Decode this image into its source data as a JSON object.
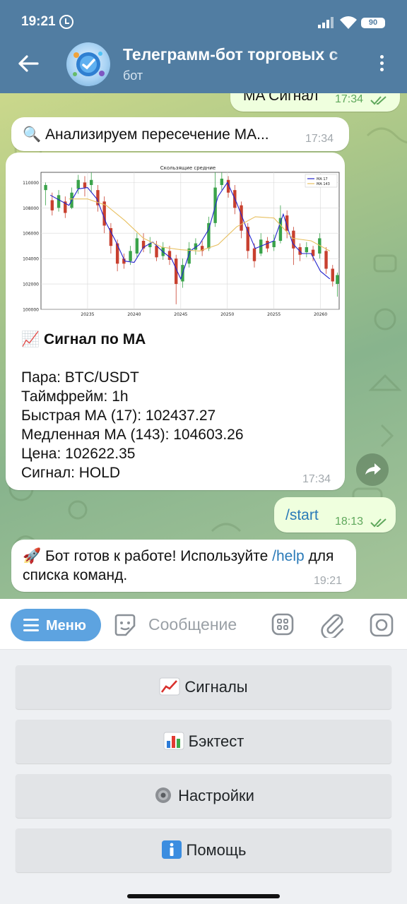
{
  "status_bar": {
    "time": "19:21",
    "battery": "90"
  },
  "chat": {
    "title": "Телеграмм-бот торговых с",
    "subtitle": "бот"
  },
  "messages": [
    {
      "text": "MA Сигнал",
      "time": "17:34"
    },
    {
      "text": "🔍 Анализируем пересечение МА...",
      "time": "17:34"
    },
    {
      "chart_title": "Скользящие средние",
      "heading": "📈 Сигнал по MA",
      "lines": [
        "Пара: BTC/USDT",
        "Таймфрейм: 1h",
        "Быстрая МА (17): 102437.27",
        "Медленная МА (143): 104603.26",
        "Цена: 102622.35",
        "Сигнал: HOLD"
      ],
      "time": "17:34"
    },
    {
      "text": "/start",
      "time": "18:13"
    },
    {
      "emoji": "🚀",
      "text_before": " Бот готов к работе! Используйте ",
      "link": "/help",
      "text_after": " для списка команд.",
      "time": "19:21"
    }
  ],
  "input": {
    "menu_label": "Меню",
    "placeholder": "Сообщение"
  },
  "keyboard": [
    {
      "icon": "chart-up-icon",
      "label": "Сигналы"
    },
    {
      "icon": "bar-chart-icon",
      "label": "Бэктест"
    },
    {
      "icon": "gear-icon",
      "label": "Настройки"
    },
    {
      "icon": "info-icon",
      "label": "Помощь"
    }
  ],
  "chart_data": {
    "type": "line",
    "title": "Скользящие средние",
    "legend_position": "top-right",
    "grid": true,
    "x_ticks": [
      "20235",
      "20240",
      "20245",
      "20250",
      "20255",
      "20260"
    ],
    "y_ticks": [
      100000,
      102000,
      104000,
      106000,
      108000,
      110000
    ],
    "ylim": [
      100000,
      110800
    ],
    "x_range": [
      20230,
      20262
    ],
    "series": [
      {
        "name": "MA 17",
        "color": "#2222cc",
        "x": [
          20231,
          20233,
          20234,
          20235,
          20236,
          20237,
          20238,
          20239,
          20240,
          20241,
          20242,
          20243,
          20244,
          20245,
          20246,
          20247,
          20248,
          20249,
          20250,
          20251,
          20252,
          20253,
          20254,
          20255,
          20256,
          20257,
          20258,
          20259,
          20260,
          20261
        ],
        "y": [
          109000,
          108200,
          109500,
          109600,
          108700,
          106800,
          105400,
          103800,
          103700,
          104900,
          105300,
          104600,
          104000,
          102400,
          104600,
          105100,
          106300,
          108900,
          110000,
          108400,
          106500,
          104800,
          105100,
          105400,
          107500,
          105200,
          104400,
          104400,
          103000,
          102400
        ]
      },
      {
        "name": "MA 143",
        "color": "#e8c060",
        "x": [
          20233,
          20235,
          20237,
          20239,
          20241,
          20243,
          20245,
          20247,
          20249,
          20251,
          20253,
          20255,
          20257,
          20259,
          20261
        ],
        "y": [
          108700,
          108700,
          108200,
          107000,
          105600,
          104900,
          104700,
          104600,
          105100,
          106500,
          107300,
          107200,
          105600,
          105400,
          104600
        ]
      }
    ],
    "candles": [
      {
        "x": 20230.5,
        "o": 109400,
        "c": 109800,
        "h": 110000,
        "l": 108200
      },
      {
        "x": 20231.2,
        "o": 108600,
        "c": 107800,
        "h": 109200,
        "l": 107400
      },
      {
        "x": 20231.9,
        "o": 108000,
        "c": 109000,
        "h": 109400,
        "l": 107700
      },
      {
        "x": 20232.6,
        "o": 108500,
        "c": 107600,
        "h": 108900,
        "l": 107200
      },
      {
        "x": 20233.3,
        "o": 108000,
        "c": 109200,
        "h": 109600,
        "l": 107900
      },
      {
        "x": 20234,
        "o": 109500,
        "c": 110200,
        "h": 110600,
        "l": 109100
      },
      {
        "x": 20234.7,
        "o": 110000,
        "c": 109600,
        "h": 110500,
        "l": 108900
      },
      {
        "x": 20235.4,
        "o": 109800,
        "c": 110200,
        "h": 110800,
        "l": 109200
      },
      {
        "x": 20236.1,
        "o": 109400,
        "c": 108200,
        "h": 109800,
        "l": 107700
      },
      {
        "x": 20236.8,
        "o": 108500,
        "c": 106600,
        "h": 108900,
        "l": 106000
      },
      {
        "x": 20237.5,
        "o": 106400,
        "c": 105000,
        "h": 106800,
        "l": 104400
      },
      {
        "x": 20238.2,
        "o": 105200,
        "c": 103600,
        "h": 105500,
        "l": 103000
      },
      {
        "x": 20238.9,
        "o": 104000,
        "c": 103600,
        "h": 104400,
        "l": 103200
      },
      {
        "x": 20239.6,
        "o": 103800,
        "c": 104600,
        "h": 105000,
        "l": 103500
      },
      {
        "x": 20240.3,
        "o": 104400,
        "c": 105600,
        "h": 106000,
        "l": 104100
      },
      {
        "x": 20241,
        "o": 105400,
        "c": 104800,
        "h": 106000,
        "l": 104500
      },
      {
        "x": 20241.7,
        "o": 104900,
        "c": 105200,
        "h": 105700,
        "l": 104400
      },
      {
        "x": 20242.4,
        "o": 105000,
        "c": 104100,
        "h": 105400,
        "l": 103800
      },
      {
        "x": 20243.1,
        "o": 104200,
        "c": 104900,
        "h": 105300,
        "l": 103900
      },
      {
        "x": 20243.8,
        "o": 104600,
        "c": 103900,
        "h": 105000,
        "l": 103500
      },
      {
        "x": 20244.5,
        "o": 104000,
        "c": 102000,
        "h": 104300,
        "l": 100400
      },
      {
        "x": 20245.2,
        "o": 102200,
        "c": 103500,
        "h": 104000,
        "l": 101700
      },
      {
        "x": 20245.9,
        "o": 103600,
        "c": 104800,
        "h": 105300,
        "l": 103300
      },
      {
        "x": 20246.6,
        "o": 104700,
        "c": 105200,
        "h": 105600,
        "l": 104300
      },
      {
        "x": 20247.3,
        "o": 105000,
        "c": 104600,
        "h": 105400,
        "l": 104200
      },
      {
        "x": 20248,
        "o": 104800,
        "c": 106800,
        "h": 107300,
        "l": 104600
      },
      {
        "x": 20248.7,
        "o": 106800,
        "c": 109600,
        "h": 110800,
        "l": 106500
      },
      {
        "x": 20249.4,
        "o": 109800,
        "c": 110300,
        "h": 110800,
        "l": 109400
      },
      {
        "x": 20250.1,
        "o": 110200,
        "c": 109200,
        "h": 110500,
        "l": 108800
      },
      {
        "x": 20250.8,
        "o": 109400,
        "c": 108000,
        "h": 109800,
        "l": 107500
      },
      {
        "x": 20251.5,
        "o": 108200,
        "c": 106200,
        "h": 108500,
        "l": 105600
      },
      {
        "x": 20252.2,
        "o": 106500,
        "c": 104600,
        "h": 106800,
        "l": 104000
      },
      {
        "x": 20252.9,
        "o": 104800,
        "c": 103800,
        "h": 105200,
        "l": 103300
      },
      {
        "x": 20253.6,
        "o": 104400,
        "c": 105500,
        "h": 106000,
        "l": 104200
      },
      {
        "x": 20254.3,
        "o": 105400,
        "c": 104800,
        "h": 105700,
        "l": 104500
      },
      {
        "x": 20255,
        "o": 104900,
        "c": 105400,
        "h": 105900,
        "l": 104600
      },
      {
        "x": 20255.7,
        "o": 105400,
        "c": 107200,
        "h": 108200,
        "l": 105200
      },
      {
        "x": 20256.4,
        "o": 107400,
        "c": 106200,
        "h": 107800,
        "l": 105600
      },
      {
        "x": 20257.1,
        "o": 106200,
        "c": 104800,
        "h": 106500,
        "l": 103500
      },
      {
        "x": 20257.8,
        "o": 104900,
        "c": 104300,
        "h": 105200,
        "l": 103800
      },
      {
        "x": 20258.5,
        "o": 104500,
        "c": 104900,
        "h": 105300,
        "l": 104100
      },
      {
        "x": 20259.2,
        "o": 104700,
        "c": 104200,
        "h": 105000,
        "l": 103800
      },
      {
        "x": 20259.9,
        "o": 104400,
        "c": 105600,
        "h": 106000,
        "l": 104000
      },
      {
        "x": 20260.6,
        "o": 104600,
        "c": 103200,
        "h": 104900,
        "l": 102800
      },
      {
        "x": 20261.3,
        "o": 103200,
        "c": 102200,
        "h": 103500,
        "l": 101800
      },
      {
        "x": 20261.8,
        "o": 102000,
        "c": 102700,
        "h": 102900,
        "l": 101000
      }
    ]
  }
}
